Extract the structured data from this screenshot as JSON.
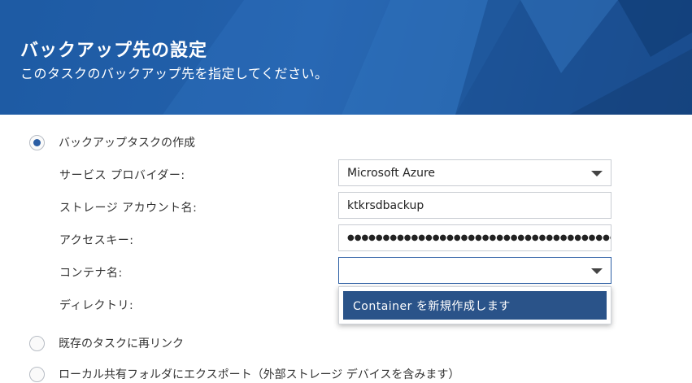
{
  "header": {
    "title": "バックアップ先の設定",
    "subtitle": "このタスクのバックアップ先を指定してください。"
  },
  "options": {
    "create_task": "バックアップタスクの作成",
    "relink_task": "既存のタスクに再リンク",
    "local_export": "ローカル共有フォルダにエクスポート（外部ストレージ デバイスを含みます）"
  },
  "form": {
    "service_provider_label": "サービス プロバイダー:",
    "service_provider_value": "Microsoft Azure",
    "storage_account_label": "ストレージ アカウント名:",
    "storage_account_value": "ktkrsdbackup",
    "access_key_label": "アクセスキー:",
    "access_key_value": "●●●●●●●●●●●●●●●●●●●●●●●●●●●●●●●●●●●●●●●●●●●●●●●●●",
    "container_label": "コンテナ名:",
    "container_value": "",
    "directory_label": "ディレクトリ:"
  },
  "container_menu": {
    "create_new": "Container を新規作成します"
  },
  "colors": {
    "banner": "#2767b2",
    "accent": "#2b5ea4",
    "menu_highlight": "#2a5389"
  }
}
